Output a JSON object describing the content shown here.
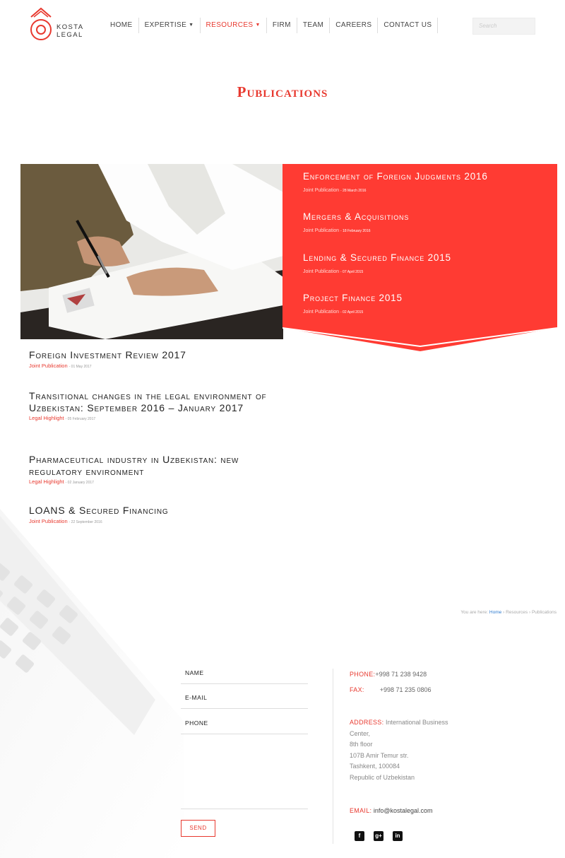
{
  "brand": {
    "name_line1": "KOSTA",
    "name_line2": "LEGAL"
  },
  "nav": {
    "items": [
      {
        "label": "Home",
        "dropdown": false,
        "active": false
      },
      {
        "label": "Expertise",
        "dropdown": true,
        "active": false
      },
      {
        "label": "Resources",
        "dropdown": true,
        "active": true
      },
      {
        "label": "Firm",
        "dropdown": false,
        "active": false
      },
      {
        "label": "Team",
        "dropdown": false,
        "active": false
      },
      {
        "label": "Careers",
        "dropdown": false,
        "active": false
      },
      {
        "label": "Contact Us",
        "dropdown": false,
        "active": false
      }
    ]
  },
  "search": {
    "placeholder": "Search"
  },
  "page": {
    "title": "Publications"
  },
  "featured": [
    {
      "title": "Enforcement of Foreign Judgments 2016",
      "category": "Joint Publication",
      "date": "- 28 March 2016"
    },
    {
      "title": "Mergers & Acquisitions",
      "category": "Joint Publication",
      "date": "- 18 February 2016"
    },
    {
      "title": "Lending & Secured Finance 2015",
      "category": "Joint Publication",
      "date": "- 07 April 2015"
    },
    {
      "title": "Project Finance 2015",
      "category": "Joint Publication",
      "date": "- 02 April 2015"
    }
  ],
  "publications": [
    {
      "title": "Foreign Investment Review 2017",
      "category": "Joint Publication",
      "date": "- 01 May 2017"
    },
    {
      "title": "Transitional changes in the legal environment of Uzbekistan: September 2016 – January 2017",
      "category": "Legal Highlight",
      "date": "- 05 February 2017"
    },
    {
      "title": "Pharmaceutical industry in Uzbekistan: new regulatory environment",
      "category": "Legal Highlight",
      "date": "- 02 January 2017"
    },
    {
      "title": "LOANS & Secured Financing",
      "category": "Joint Publication",
      "date": "- 22 September 2016"
    }
  ],
  "breadcrumb": {
    "prefix": "You are here:",
    "home": "Home",
    "sep": "›",
    "level1": "Resources",
    "current": "Publications"
  },
  "form": {
    "name_label": "Name",
    "email_label": "E-mail",
    "phone_label": "Phone",
    "send_label": "SEND"
  },
  "contact": {
    "phone_label": "Phone:",
    "phone": "+998 71 238 9428",
    "fax_label": "Fax:",
    "fax": "+998 71 235 0806",
    "address_label": "Address:",
    "address_line1": "International Business",
    "address_line2": "Center,",
    "address_line3": "8th floor",
    "address_line4": "107B Amir Temur str.",
    "address_line5": "Tashkent, 100084",
    "address_line6": "Republic of Uzbekistan",
    "email_label": "Email:",
    "email": "info@kostalegal.com"
  },
  "social": [
    {
      "icon": "facebook-icon",
      "glyph": "f"
    },
    {
      "icon": "google-plus-icon",
      "glyph": "g+"
    },
    {
      "icon": "linkedin-icon",
      "glyph": "in"
    }
  ],
  "colors": {
    "accent": "#e8392f",
    "featured_bg": "#ff3b33"
  }
}
